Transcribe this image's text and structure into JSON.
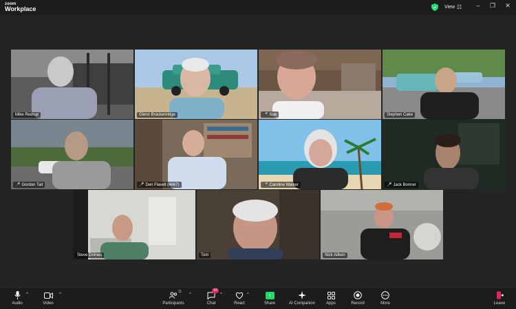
{
  "app": {
    "brand_top": "zoom",
    "brand_bottom": "Workplace"
  },
  "titlebar": {
    "view_label": "View"
  },
  "participants": [
    {
      "name": "Mike Redrup",
      "muted": false
    },
    {
      "name": "Glenn Brackenridge",
      "muted": false
    },
    {
      "name": "Sue",
      "muted": true
    },
    {
      "name": "Stephen Cake",
      "muted": false
    },
    {
      "name": "Gordon Tait",
      "muted": true
    },
    {
      "name": "Den Flavell (4667)",
      "muted": true
    },
    {
      "name": "Caroline Walker",
      "muted": true
    },
    {
      "name": "Jack Bonner",
      "muted": true
    },
    {
      "name": "Steve Grimes",
      "muted": false
    },
    {
      "name": "Tom",
      "muted": false
    },
    {
      "name": "Nick Aitken",
      "muted": false,
      "active_speaker": true
    }
  ],
  "toolbar": {
    "audio": "Audio",
    "video": "Video",
    "participants": "Participants",
    "participants_count": "11",
    "chat": "Chat",
    "chat_badge": "10",
    "react": "React",
    "share": "Share",
    "ai_companion": "AI Companion",
    "apps": "Apps",
    "record": "Record",
    "more": "More",
    "leave": "Leave"
  },
  "colors": {
    "active_speaker": "#23d96b",
    "muted": "#e0245e",
    "share": "#23d96b"
  }
}
